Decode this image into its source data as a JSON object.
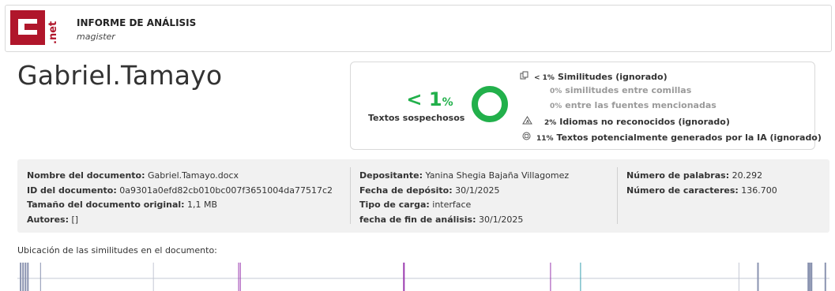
{
  "header": {
    "logo": "c.net",
    "title": "INFORME DE ANÁLISIS",
    "subtitle": "magister"
  },
  "document_author_name": "Gabriel.Tamayo",
  "summary": {
    "main_percent": "< 1",
    "main_percent_unit": "%",
    "main_label": "Textos sospechosos",
    "donut_color": "#22b04b",
    "metrics": [
      {
        "icon": "copy-icon",
        "percent": "< 1%",
        "label": "Similitudes (ignorado)"
      },
      {
        "icon": "",
        "percent": "0%",
        "label": "similitudes entre comillas"
      },
      {
        "icon": "",
        "percent": "0%",
        "label": "entre las fuentes mencionadas"
      },
      {
        "icon": "translate-warning-icon",
        "percent": "2%",
        "label": "Idiomas no reconocidos (ignorado)"
      },
      {
        "icon": "ai-chip-icon",
        "percent": "11%",
        "label": "Textos potencialmente generados por la IA (ignorado)"
      }
    ]
  },
  "details": {
    "col1": [
      {
        "label": "Nombre del documento:",
        "value": "Gabriel.Tamayo.docx"
      },
      {
        "label": "ID del documento:",
        "value": "0a9301a0efd82cb010bc007f3651004da77517c2"
      },
      {
        "label": "Tamaño del documento original:",
        "value": "1,1 MB"
      },
      {
        "label": "Autores:",
        "value": "[]"
      }
    ],
    "col2": [
      {
        "label": "Depositante:",
        "value": "Yanina Shegia Bajaña Villagomez"
      },
      {
        "label": "Fecha de depósito:",
        "value": "30/1/2025"
      },
      {
        "label": "Tipo de carga:",
        "value": "interface"
      },
      {
        "label": "fecha de fin de análisis:",
        "value": "30/1/2025"
      }
    ],
    "col3": [
      {
        "label": "Número de palabras:",
        "value": "20.292"
      },
      {
        "label": "Número de caracteres:",
        "value": "136.700"
      }
    ]
  },
  "location": {
    "label": "Ubicación de las similitudes en el documento:",
    "markers": [
      {
        "pos": 0.003,
        "color": "#8a93b0",
        "w": 2
      },
      {
        "pos": 0.006,
        "color": "#8a93b0",
        "w": 2
      },
      {
        "pos": 0.009,
        "color": "#8a93b0",
        "w": 2
      },
      {
        "pos": 0.012,
        "color": "#8a93b0",
        "w": 2
      },
      {
        "pos": 0.028,
        "color": "#8a93b0",
        "w": 1
      },
      {
        "pos": 0.167,
        "color": "#c4c8d4",
        "w": 1
      },
      {
        "pos": 0.272,
        "color": "#9b3bb0",
        "w": 1
      },
      {
        "pos": 0.274,
        "color": "#9b3bb0",
        "w": 1
      },
      {
        "pos": 0.475,
        "color": "#9b3bb0",
        "w": 2
      },
      {
        "pos": 0.656,
        "color": "#9b3bb0",
        "w": 1
      },
      {
        "pos": 0.693,
        "color": "#3aa0b0",
        "w": 1
      },
      {
        "pos": 0.888,
        "color": "#c4c8d4",
        "w": 1
      },
      {
        "pos": 0.911,
        "color": "#8a93b0",
        "w": 2
      },
      {
        "pos": 0.973,
        "color": "#8a93b0",
        "w": 3
      },
      {
        "pos": 0.976,
        "color": "#8a93b0",
        "w": 3
      },
      {
        "pos": 0.994,
        "color": "#8a93b0",
        "w": 2
      }
    ]
  }
}
